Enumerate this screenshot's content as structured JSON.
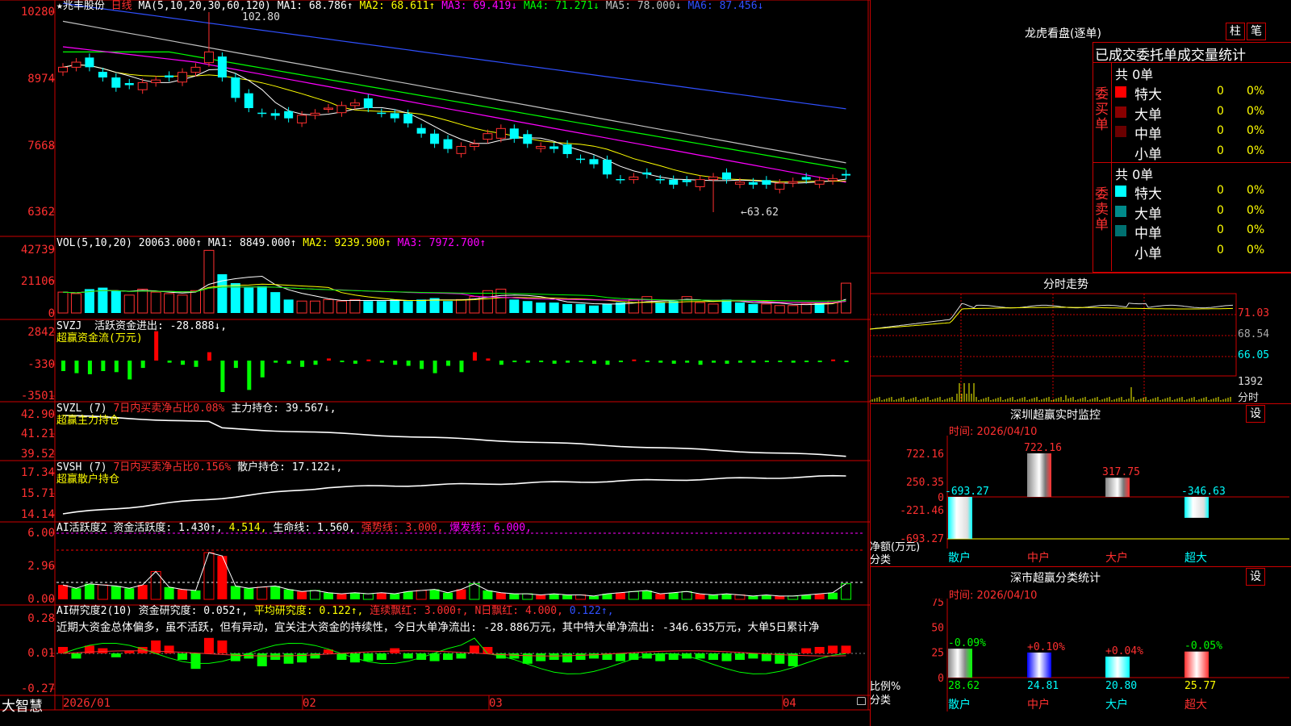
{
  "main": {
    "stock_name": "兆丰股份",
    "period": "日线",
    "ma_header": {
      "label": "MA(5,10,20,30,60,120)",
      "items": [
        {
          "name": "MA1:",
          "value": "68.786",
          "arrow": "↑",
          "color": "#ffffff"
        },
        {
          "name": "MA2:",
          "value": "68.611",
          "arrow": "↑",
          "color": "#ffff00"
        },
        {
          "name": "MA3:",
          "value": "69.419",
          "arrow": "↓",
          "color": "#ff00ff"
        },
        {
          "name": "MA4:",
          "value": "71.271",
          "arrow": "↓",
          "color": "#00ff00"
        },
        {
          "name": "MA5:",
          "value": "78.000",
          "arrow": "↓",
          "color": "#c0c0c0"
        },
        {
          "name": "MA6:",
          "value": "87.456",
          "arrow": "↓",
          "color": "#3050ff"
        }
      ]
    },
    "y_labels": [
      "10280",
      "8974",
      "7668",
      "6362"
    ],
    "high_note": "102.80",
    "low_note": "←63.62"
  },
  "vol": {
    "label": "VOL(5,10,20)",
    "value": "20063.000↑",
    "ma": [
      {
        "t": "MA1: 8849.000↑",
        "c": "#ffffff"
      },
      {
        "t": "MA2: 9239.900↑",
        "c": "#ffff00"
      },
      {
        "t": "MA3: 7972.700↑",
        "c": "#ff00ff"
      }
    ],
    "y_labels": [
      "42739",
      "21106",
      "0"
    ]
  },
  "svzj": {
    "label": "SVZJ",
    "title": "活跃资金进出:",
    "value": "-28.888↓,",
    "sub": "超赢资金流(万元)",
    "y_labels": [
      "2842",
      "-330",
      "-3501"
    ]
  },
  "svzl": {
    "label": "SVZL (7)",
    "title": "7日内买卖净占比0.08%",
    "main": "主力持仓: 39.567↓,",
    "sub": "超赢主力持仓",
    "y_labels": [
      "42.90",
      "41.21",
      "39.52"
    ]
  },
  "svsh": {
    "label": "SVSH (7)",
    "title": "7日内买卖净占比0.156%",
    "main": "散户持仓: 17.122↓,",
    "sub": "超赢散户持仓",
    "y_labels": [
      "17.34",
      "15.71",
      "14.14"
    ]
  },
  "ai1": {
    "label": "AI活跃度2",
    "t1": "资金活跃度: 1.430↑,",
    "t2": "4.514,",
    "t3": "生命线: 1.560,",
    "t4": "强势线: 3.000,",
    "t5": "爆发线: 6.000,",
    "y_labels": [
      "6.00",
      "2.96",
      "0.00"
    ]
  },
  "ai2": {
    "label": "AI研究度2(10)",
    "t1": "资金研究度: 0.052↑,",
    "t2": "平均研究度: 0.122↑,",
    "t3": "连续飘红: 3.000↑,",
    "t4": "N日飘红: 4.000,",
    "t5": "0.122↑,",
    "desc": "近期大资金总体偏多，虽不活跃，但有异动，宜关注大资金的持续性，今日大单净流出: -28.886万元，其中特大单净流出: -346.635万元，大单5日累计净",
    "y_labels": [
      "0.28",
      "0.01",
      "-0.27"
    ]
  },
  "xaxis": {
    "logo": "大智慧",
    "labels": [
      "2026/01",
      "02",
      "03",
      "04"
    ]
  },
  "lhb": {
    "title": "龙虎看盘(逐单)",
    "btn1": "柱",
    "btn2": "笔",
    "subtitle": "已成交委托单成交量统计",
    "buy": {
      "side": "委买单",
      "count": "共 0单",
      "rows": [
        {
          "name": "特大",
          "v": "0",
          "p": "0%",
          "c": "#ff0000"
        },
        {
          "name": "大单",
          "v": "0",
          "p": "0%",
          "c": "#8a0000"
        },
        {
          "name": "中单",
          "v": "0",
          "p": "0%",
          "c": "#6a0000"
        },
        {
          "name": "小单",
          "v": "0",
          "p": "0%",
          "c": "#000000"
        }
      ]
    },
    "sell": {
      "side": "委卖单",
      "count": "共 0单",
      "rows": [
        {
          "name": "特大",
          "v": "0",
          "p": "0%",
          "c": "#00ffff"
        },
        {
          "name": "大单",
          "v": "0",
          "p": "0%",
          "c": "#008a8a"
        },
        {
          "name": "中单",
          "v": "0",
          "p": "0%",
          "c": "#007070"
        },
        {
          "name": "小单",
          "v": "0",
          "p": "0%",
          "c": "#000000"
        }
      ]
    }
  },
  "fenshi": {
    "title": "分时走势",
    "y_labels": [
      "71.03",
      "68.54",
      "66.05"
    ],
    "vol_label": "1392",
    "vol_unit": "分时"
  },
  "sz_monitor": {
    "title": "深圳超赢实时监控",
    "btn": "设",
    "time": "时间: 2026/04/10",
    "y_labels": [
      "722.16",
      "250.35",
      "0",
      "-221.46",
      "-693.27"
    ],
    "bars": [
      {
        "cat": "散户",
        "v": -693.27,
        "label": "-693.27"
      },
      {
        "cat": "中户",
        "v": 722.16,
        "label": "722.16"
      },
      {
        "cat": "大户",
        "v": 317.75,
        "label": "317.75"
      },
      {
        "cat": "超大",
        "v": -346.63,
        "label": "-346.63"
      }
    ],
    "axis_note1": "净额(万元)",
    "axis_note2": "分类"
  },
  "sz_class": {
    "title": "深市超赢分类统计",
    "btn": "设",
    "time": "时间: 2026/04/10",
    "y_labels": [
      "75",
      "50",
      "25",
      "0"
    ],
    "bars": [
      {
        "cat": "散户",
        "v": 28.62,
        "top": "-0.09%",
        "bot": "28.62"
      },
      {
        "cat": "中户",
        "v": 24.81,
        "top": "+0.10%",
        "bot": "24.81"
      },
      {
        "cat": "大户",
        "v": 20.8,
        "top": "+0.04%",
        "bot": "20.80"
      },
      {
        "cat": "超大",
        "v": 25.77,
        "top": "-0.05%",
        "bot": "25.77"
      }
    ],
    "axis_note1": "比例%",
    "axis_note2": "分类"
  }
}
